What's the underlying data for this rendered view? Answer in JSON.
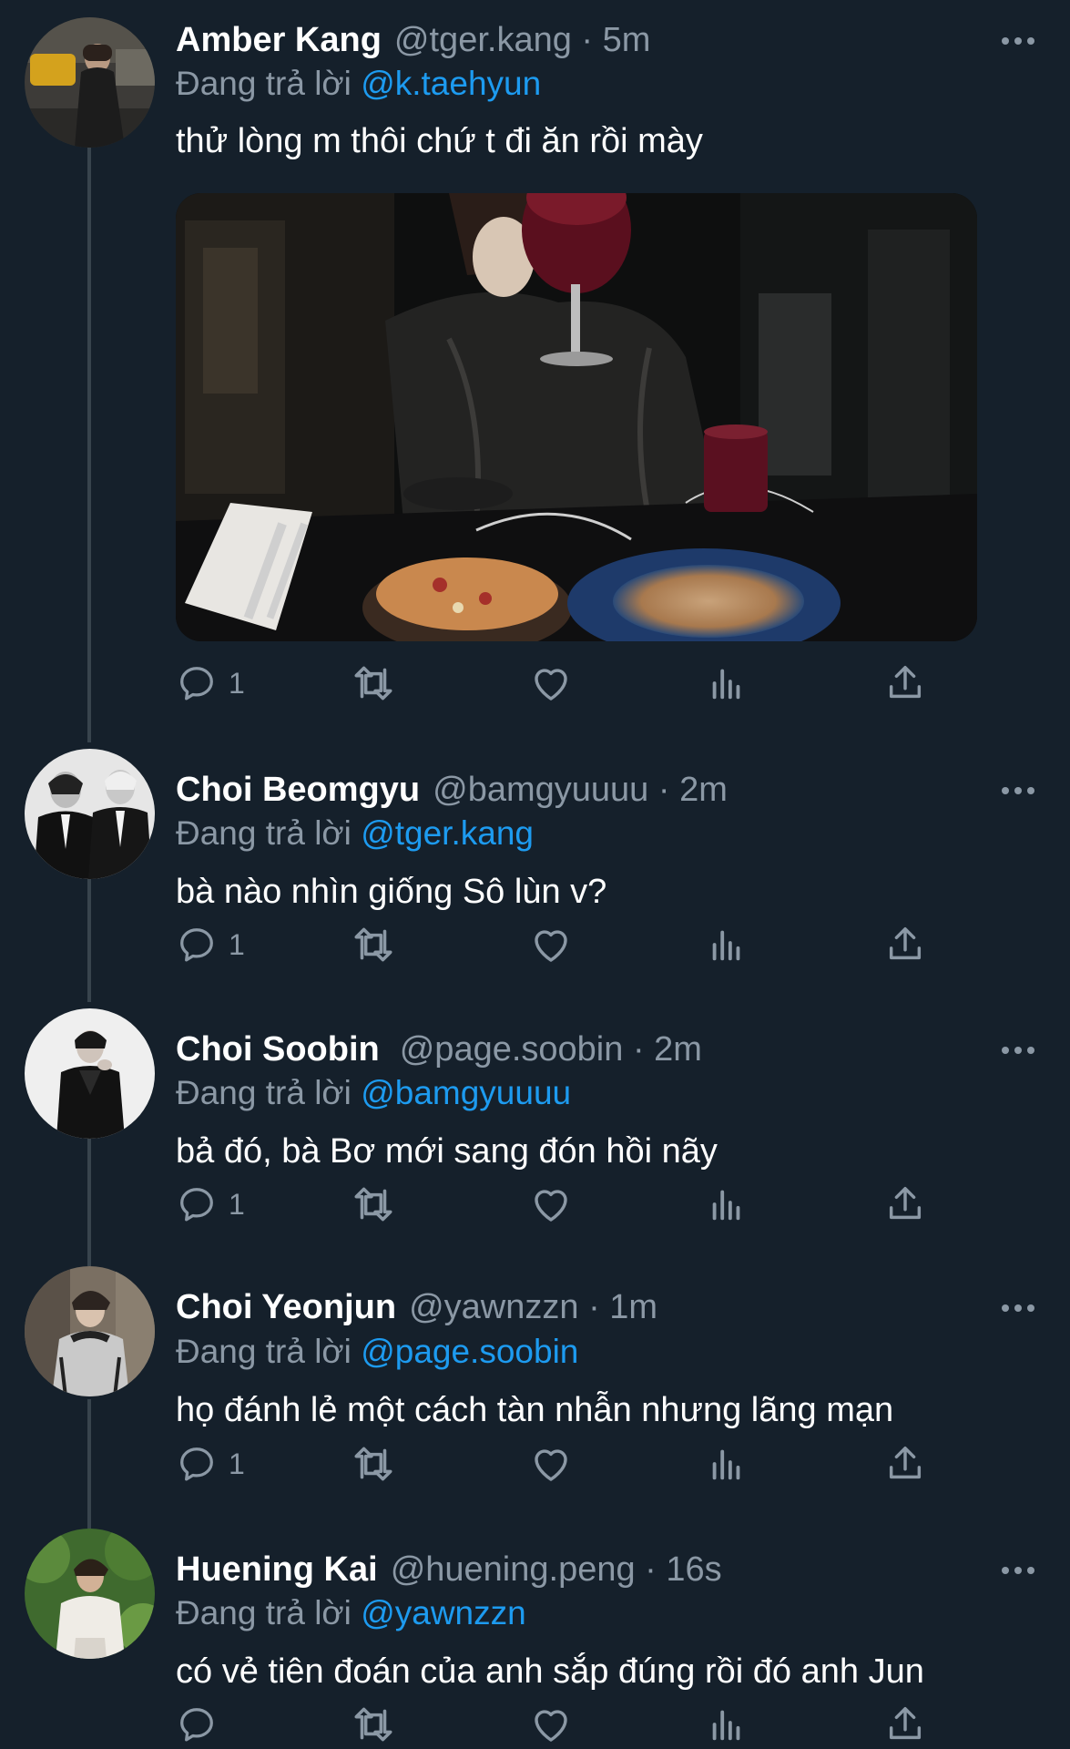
{
  "tweets": [
    {
      "name": "Amber Kang",
      "handle": "@tger.kang",
      "time": "5m",
      "reply_prefix": "Đang trả lời",
      "reply_to": "@k.taehyun",
      "text": "thử lòng m thôi chứ t đi ăn rồi mày",
      "reply_count": "1",
      "has_media": true
    },
    {
      "name": "Choi Beomgyu",
      "handle": "@bamgyuuuu",
      "time": "2m",
      "reply_prefix": "Đang trả lời",
      "reply_to": "@tger.kang",
      "text": "bà nào nhìn giống Sô lùn v?",
      "reply_count": "1"
    },
    {
      "name": "Choi Soobin",
      "handle": "@page.soobin",
      "time": "2m",
      "reply_prefix": "Đang trả lời",
      "reply_to": "@bamgyuuuu",
      "text": "bả đó, bà Bơ mới sang đón hồi nãy",
      "reply_count": "1"
    },
    {
      "name": "Choi Yeonjun",
      "handle": "@yawnzzn",
      "time": "1m",
      "reply_prefix": "Đang trả lời",
      "reply_to": "@page.soobin",
      "text": "họ đánh lẻ một cách tàn nhẫn nhưng lãng mạn",
      "reply_count": "1"
    },
    {
      "name": "Huening Kai",
      "handle": "@huening.peng",
      "time": "16s",
      "reply_prefix": "Đang trả lời",
      "reply_to": "@yawnzzn",
      "text": "có vẻ tiên đoán của anh sắp đúng rồi đó anh Jun",
      "reply_count": ""
    }
  ],
  "separator": " · ",
  "icons": {
    "reply": "reply-icon",
    "retweet": "retweet-icon",
    "like": "like-icon",
    "views": "views-icon",
    "share": "share-icon",
    "more": "more-icon"
  },
  "colors": {
    "background": "#15202b",
    "secondary_text": "#8b98a5",
    "mention": "#1d9bf0",
    "thread_line": "#38444d"
  }
}
